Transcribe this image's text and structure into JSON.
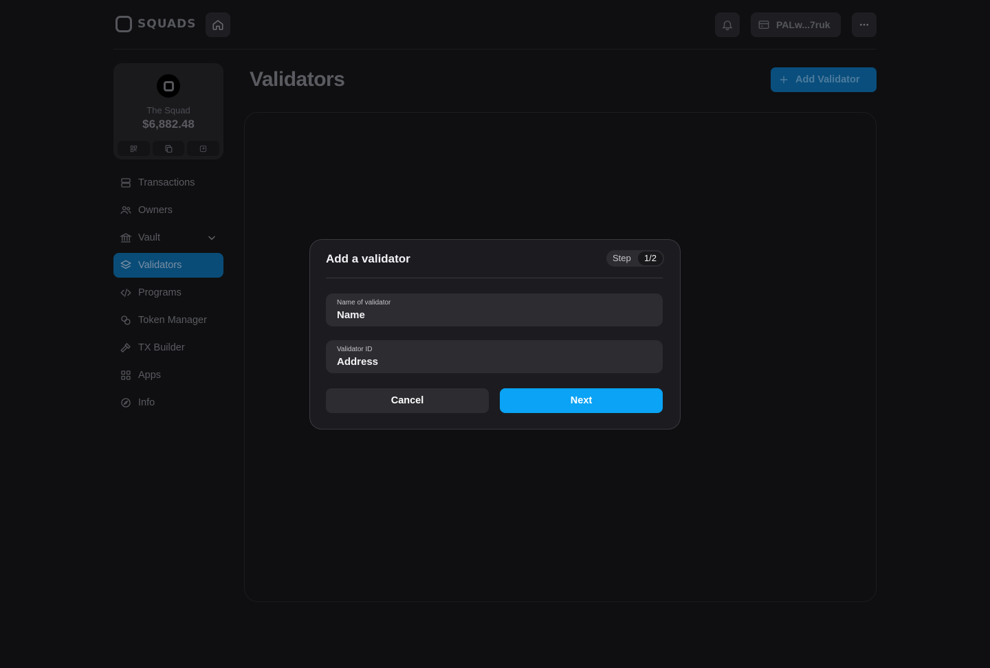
{
  "app": {
    "logo_text": "SQUADS",
    "wallet_address": "PALw...7ruk"
  },
  "squad": {
    "name": "The Squad",
    "balance": "$6,882.48"
  },
  "nav": {
    "items": [
      {
        "label": "Transactions",
        "icon": "transactions-icon"
      },
      {
        "label": "Owners",
        "icon": "owners-icon"
      },
      {
        "label": "Vault",
        "icon": "vault-icon"
      },
      {
        "label": "Validators",
        "icon": "validators-icon",
        "active": true
      },
      {
        "label": "Programs",
        "icon": "code-icon"
      },
      {
        "label": "Token Manager",
        "icon": "coins-icon"
      },
      {
        "label": "TX Builder",
        "icon": "hammer-icon"
      },
      {
        "label": "Apps",
        "icon": "apps-icon"
      },
      {
        "label": "Info",
        "icon": "compass-icon"
      }
    ]
  },
  "page": {
    "title": "Validators",
    "add_button_label": "Add Validator"
  },
  "modal": {
    "title": "Add a validator",
    "step_label": "Step",
    "step_count": "1/2",
    "fields": [
      {
        "label": "Name of validator",
        "placeholder": "Name"
      },
      {
        "label": "Validator ID",
        "placeholder": "Address"
      }
    ],
    "cancel_label": "Cancel",
    "next_label": "Next"
  },
  "colors": {
    "background": "#0f0f11",
    "accent": "#0aa3f5",
    "active_nav": "#0a4c78",
    "modal_bg": "#1c1c20"
  }
}
